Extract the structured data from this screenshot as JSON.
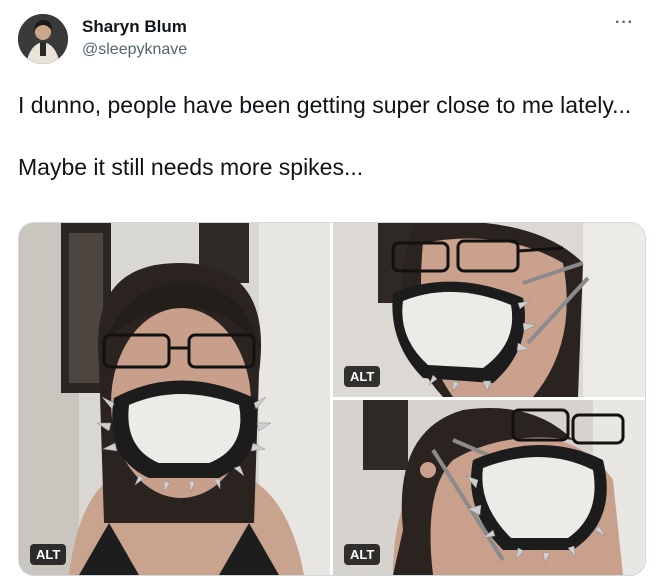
{
  "tweet": {
    "author_name": "Sharyn Blum",
    "author_handle": "@sleepyknave",
    "more_label": "···",
    "text_line1": "I dunno, people have been getting super close to me lately...",
    "text_line2": "Maybe it still needs more spikes..."
  },
  "media": {
    "alt_label": "ALT"
  }
}
